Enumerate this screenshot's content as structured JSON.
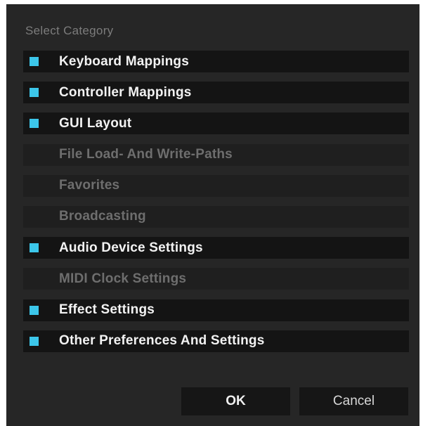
{
  "dialog": {
    "title": "Select Category",
    "categories": [
      {
        "label": "Keyboard Mappings",
        "checked": true
      },
      {
        "label": "Controller Mappings",
        "checked": true
      },
      {
        "label": "GUI Layout",
        "checked": true
      },
      {
        "label": "File Load- And Write-Paths",
        "checked": false
      },
      {
        "label": "Favorites",
        "checked": false
      },
      {
        "label": "Broadcasting",
        "checked": false
      },
      {
        "label": "Audio Device Settings",
        "checked": true
      },
      {
        "label": "MIDI Clock Settings",
        "checked": false
      },
      {
        "label": "Effect Settings",
        "checked": true
      },
      {
        "label": "Other Preferences And Settings",
        "checked": true
      }
    ],
    "ok_label": "OK",
    "cancel_label": "Cancel"
  },
  "colors": {
    "accent": "#3cc6ea",
    "background": "#262626",
    "row_active": "#141414",
    "row_inactive": "#1f1f1f"
  }
}
